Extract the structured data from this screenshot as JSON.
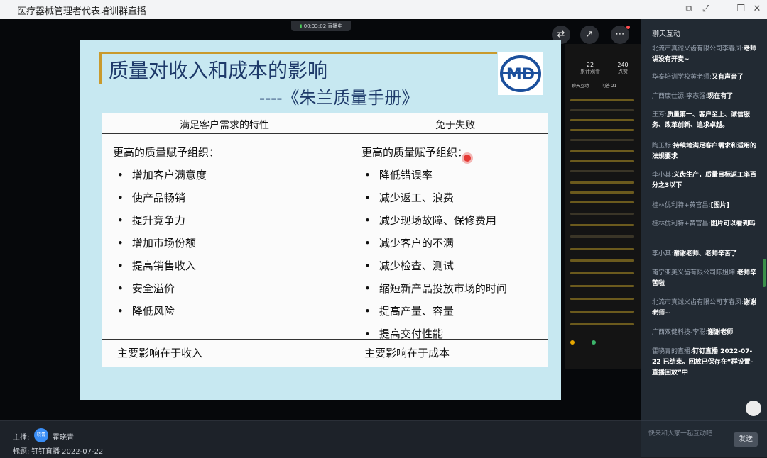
{
  "window": {
    "title": "医疗器械管理者代表培训群直播"
  },
  "video": {
    "live_time": "00:33:02",
    "live_status": "直播中"
  },
  "slide": {
    "title": "质量对收入和成本的影响",
    "subtitle": "----《朱兰质量手册》",
    "col1_header": "满足客户需求的特性",
    "col2_header": "免于失败",
    "col1_sub": "更高的质量赋予组织：",
    "col2_sub": "更高的质量赋予组织：",
    "col1_items": [
      "增加客户满意度",
      "使产品畅销",
      "提升竞争力",
      "增加市场份额",
      "提高销售收入",
      "安全溢价",
      "降低风险"
    ],
    "col2_items": [
      "降低错误率",
      "减少返工、浪费",
      "减少现场故障、保修费用",
      "减少客户的不满",
      "减少检查、测试",
      "缩短新产品投放市场的时间",
      "提高产量、容量",
      "提高交付性能"
    ],
    "col1_footer": "主要影响在于收入",
    "col2_footer": "主要影响在于成本"
  },
  "mini_panel": {
    "stat1_value": "22",
    "stat1_label": "累计观看",
    "stat2_value": "240",
    "stat2_label": "点赞",
    "tab1": "聊天互动",
    "tab2": "问答 21"
  },
  "bottom": {
    "host_label": "主播:",
    "host_name": "霍晓青",
    "avatar_text": "晓青",
    "title_label": "标题:",
    "title_value": "钉钉直播 2022-07-22"
  },
  "chat": {
    "header": "聊天互动",
    "messages": [
      {
        "user": "北流市真诚义齿有限公司李春凤:",
        "text": "老师讲没有开麦~"
      },
      {
        "user": "华泰培训学校黄老师:",
        "text": "又有声音了"
      },
      {
        "user": "广西康仕源-李志强:",
        "text": "现在有了"
      },
      {
        "user": "王芳:",
        "text": "质量第一、客户至上、诚信服务、改革创新、追求卓越。"
      },
      {
        "user": "陶玉标:",
        "text": "持续地满足客户需求和适用的法规要求"
      },
      {
        "user": "李小其:",
        "text": "义齿生产，质量目标返工率百分之3以下"
      },
      {
        "user": "桂林优利特+黄官昌:",
        "text": "[图片]"
      },
      {
        "user": "桂林优利特+黄官昌:",
        "text": "图片可以看到吗"
      },
      {
        "user": "李小其:",
        "text": "谢谢老师、老师辛苦了"
      },
      {
        "user": "南宁亚美义齿有限公司陈姐坤:",
        "text": "老师辛苦啦"
      },
      {
        "user": "北流市真诚义齿有限公司李春凤:",
        "text": "谢谢老师~"
      },
      {
        "user": "广西双健科技-李聪:",
        "text": "谢谢老师"
      },
      {
        "user": "霍晓青的直播:",
        "text": "钉钉直播 2022-07-22 已结束。回放已保存在“群设置-直播回放”中"
      }
    ],
    "input_placeholder": "快来和大家一起互动吧",
    "send_label": "发送"
  }
}
